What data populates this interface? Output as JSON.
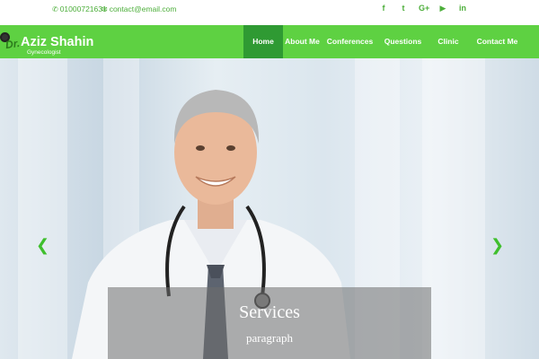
{
  "topbar": {
    "phone": "01000721631",
    "email": "contact@email.com",
    "social": [
      {
        "icon": "facebook-icon",
        "glyph": "f"
      },
      {
        "icon": "twitter-icon",
        "glyph": "t"
      },
      {
        "icon": "google-plus-icon",
        "glyph": "G+"
      },
      {
        "icon": "youtube-icon",
        "glyph": "▶"
      },
      {
        "icon": "linkedin-icon",
        "glyph": "in"
      }
    ]
  },
  "brand": {
    "prefix": "Dr.",
    "name": "Aziz Shahin",
    "title": "Gynecologist"
  },
  "nav": {
    "items": [
      {
        "label": "Home",
        "active": true
      },
      {
        "label": "About Me",
        "active": false
      },
      {
        "label": "Conferences",
        "active": false
      },
      {
        "label": "Questions",
        "active": false
      },
      {
        "label": "Clinic",
        "active": false
      },
      {
        "label": "Contact Me",
        "active": false
      }
    ]
  },
  "hero": {
    "prev_arrow": "❮",
    "next_arrow": "❯",
    "caption_heading": "Services",
    "caption_text": "paragraph"
  },
  "colors": {
    "accent": "#5ed142",
    "accent_dark": "#2f9a33",
    "icon_green": "#4cae3a"
  }
}
